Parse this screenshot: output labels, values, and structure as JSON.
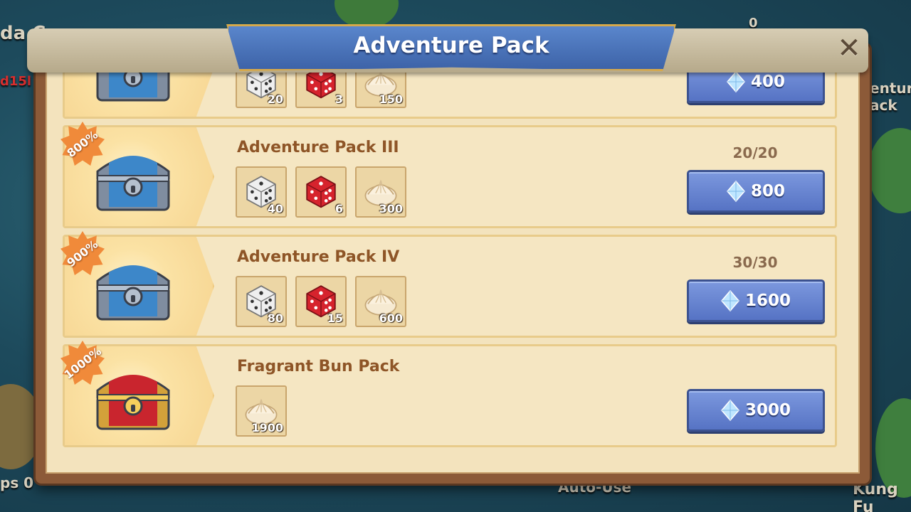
{
  "window": {
    "title": "Adventure Pack"
  },
  "background": {
    "fragment_top_left": "da C",
    "fragment_left_red": "d15l",
    "fragment_right": "enture\nack",
    "fragment_bottom_left": "ps 0",
    "fragment_bottom_center": "Auto-Use",
    "fragment_bottom_right": "Kung Fu",
    "fragment_top_right": "0"
  },
  "packs": [
    {
      "name": "",
      "badge": "",
      "chest": "blue-chest",
      "limit": "",
      "price": "400",
      "items": [
        {
          "icon": "white-dice",
          "qty": "20"
        },
        {
          "icon": "red-dice",
          "qty": "3"
        },
        {
          "icon": "bun",
          "qty": "150"
        }
      ]
    },
    {
      "name": "Adventure Pack III",
      "badge": "800%",
      "chest": "blue-chest",
      "limit": "20/20",
      "price": "800",
      "items": [
        {
          "icon": "white-dice",
          "qty": "40"
        },
        {
          "icon": "red-dice",
          "qty": "6"
        },
        {
          "icon": "bun",
          "qty": "300"
        }
      ]
    },
    {
      "name": "Adventure Pack IV",
      "badge": "900%",
      "chest": "blue-chest",
      "limit": "30/30",
      "price": "1600",
      "items": [
        {
          "icon": "white-dice",
          "qty": "80"
        },
        {
          "icon": "red-dice",
          "qty": "15"
        },
        {
          "icon": "bun",
          "qty": "600"
        }
      ]
    },
    {
      "name": "Fragrant Bun Pack",
      "badge": "1000%",
      "chest": "gold-chest",
      "limit": "",
      "price": "3000",
      "items": [
        {
          "icon": "bun",
          "qty": "1900"
        }
      ]
    }
  ],
  "colors": {
    "accent_blue": "#5673c4",
    "panel": "#f3e3bd",
    "title_text": "#8e5527",
    "badge": "#f08a3a"
  }
}
